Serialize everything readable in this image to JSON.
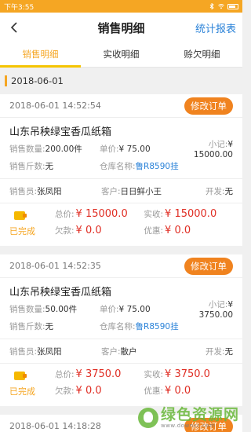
{
  "status_bar": {
    "time": "下午3:55"
  },
  "navbar": {
    "title": "销售明细",
    "right_action": "统计报表"
  },
  "tabs": [
    {
      "label": "销售明细",
      "active": true
    },
    {
      "label": "实收明细",
      "active": false
    },
    {
      "label": "赊欠明细",
      "active": false
    }
  ],
  "date_group": {
    "date": "2018-06-01"
  },
  "labels": {
    "qty": "销售数量:",
    "unit_price": "单价:",
    "subtotal": "小记:",
    "weight": "销售斤数:",
    "warehouse": "仓库名称:",
    "seller": "销售员:",
    "customer": "客户:",
    "invoice": "开发:",
    "total": "总价:",
    "received": "实收:",
    "owed": "欠款:",
    "discount": "优惠:",
    "modify": "修改订单"
  },
  "orders": [
    {
      "time": "2018-06-01 14:52:54",
      "product": "山东吊秧绿宝香瓜纸箱",
      "qty": "200.00件",
      "unit_price": "¥ 75.00",
      "subtotal": "¥ 15000.00",
      "weight": "无",
      "warehouse": "鲁R8590挂",
      "seller": "张凤阳",
      "customer": "日日鲜小王",
      "invoice": "无",
      "status": "已完成",
      "total": "¥ 15000.0",
      "received": "¥ 15000.0",
      "owed": "¥ 0.0",
      "discount": "¥ 0.0"
    },
    {
      "time": "2018-06-01 14:52:35",
      "product": "山东吊秧绿宝香瓜纸箱",
      "qty": "50.00件",
      "unit_price": "¥ 75.00",
      "subtotal": "¥ 3750.00",
      "weight": "无",
      "warehouse": "鲁R8590挂",
      "seller": "张凤阳",
      "customer": "散户",
      "invoice": "无",
      "status": "已完成",
      "total": "¥ 3750.0",
      "received": "¥ 3750.0",
      "owed": "¥ 0.0",
      "discount": "¥ 0.0"
    },
    {
      "time": "2018-06-01 14:18:28"
    }
  ],
  "watermark": {
    "text": "绿色资源网",
    "url": "www.downcc.com"
  },
  "colors": {
    "accent": "#f5a623",
    "button": "#f0831f",
    "link": "#2a82d8",
    "price": "#e02e24"
  }
}
